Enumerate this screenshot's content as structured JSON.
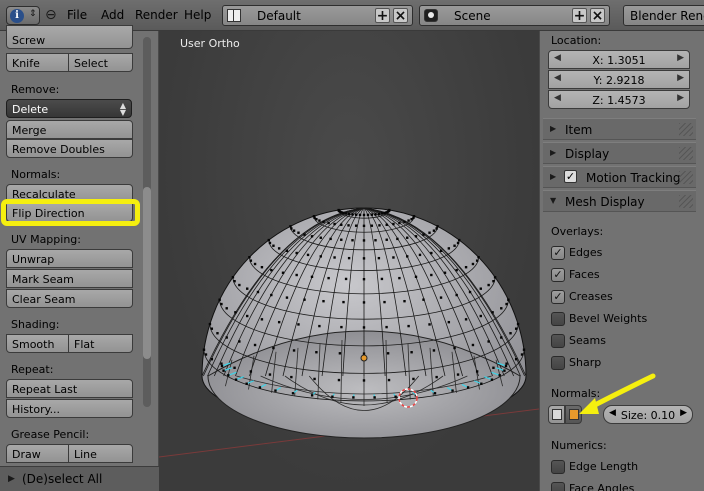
{
  "header": {
    "menus": [
      "File",
      "Add",
      "Render",
      "Help"
    ],
    "layout_name": "Default",
    "scene_name": "Scene",
    "render_engine": "Blender Rende"
  },
  "left_panel": {
    "top_buttons": {
      "screw": "Screw",
      "knife": "Knife",
      "select": "Select"
    },
    "remove": {
      "label": "Remove:",
      "dropdown": "Delete",
      "merge": "Merge",
      "remove_doubles": "Remove Doubles"
    },
    "normals": {
      "label": "Normals:",
      "recalculate": "Recalculate",
      "flip_direction": "Flip Direction"
    },
    "uv_mapping": {
      "label": "UV Mapping:",
      "unwrap": "Unwrap",
      "mark_seam": "Mark Seam",
      "clear_seam": "Clear Seam"
    },
    "shading": {
      "label": "Shading:",
      "smooth": "Smooth",
      "flat": "Flat"
    },
    "repeat": {
      "label": "Repeat:",
      "repeat_last": "Repeat Last",
      "history": "History..."
    },
    "grease_pencil": {
      "label": "Grease Pencil:",
      "draw": "Draw",
      "line": "Line"
    },
    "footer": "(De)select All"
  },
  "viewport": {
    "title": "User Ortho"
  },
  "right_panel": {
    "location": {
      "label": "Location:",
      "x": "X: 1.3051",
      "y": "Y: 2.9218",
      "z": "Z: 1.4573"
    },
    "sections": {
      "item": "Item",
      "display": "Display",
      "motion_tracking": "Motion Tracking",
      "mesh_display": "Mesh Display"
    },
    "overlays": {
      "label": "Overlays:",
      "items": [
        {
          "label": "Edges",
          "checked": true
        },
        {
          "label": "Faces",
          "checked": true
        },
        {
          "label": "Creases",
          "checked": true
        },
        {
          "label": "Bevel Weights",
          "checked": false
        },
        {
          "label": "Seams",
          "checked": false
        },
        {
          "label": "Sharp",
          "checked": false
        }
      ]
    },
    "normals": {
      "label": "Normals:",
      "size": "Size: 0.10"
    },
    "numerics": {
      "label": "Numerics:",
      "edge_length": "Edge Length",
      "face_angles": "Face Angles"
    }
  },
  "colors": {
    "highlight": "#f5ef0f",
    "selected_orange": "#e79a2c",
    "normals_cyan": "#3fd3e8"
  },
  "icons": [
    "info-icon",
    "collapse-icon",
    "layout-icon",
    "scene-icon",
    "add-icon",
    "close-icon",
    "vertex-normals-icon",
    "face-normals-icon"
  ]
}
